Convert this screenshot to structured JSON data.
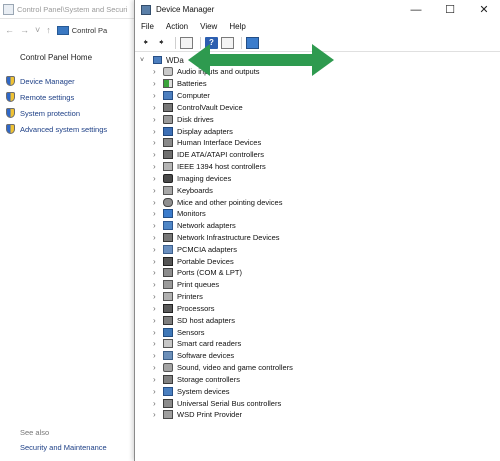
{
  "control_panel": {
    "title": "Control Panel\\System and Securi",
    "address": "Control Pa",
    "home_link": "Control Panel Home",
    "links": [
      "Device Manager",
      "Remote settings",
      "System protection",
      "Advanced system settings"
    ],
    "see_also": "See also",
    "security_maintenance": "Security and Maintenance"
  },
  "device_manager": {
    "title": "Device Manager",
    "menus": [
      "File",
      "Action",
      "View",
      "Help"
    ],
    "root_label": "WDa",
    "categories": [
      {
        "label": "Audio inputs and outputs",
        "icon": "speaker-icon"
      },
      {
        "label": "Batteries",
        "icon": "battery-icon"
      },
      {
        "label": "Computer",
        "icon": "computer-icon"
      },
      {
        "label": "ControlVault Device",
        "icon": "controlvault-icon"
      },
      {
        "label": "Disk drives",
        "icon": "disk-drive-icon"
      },
      {
        "label": "Display adapters",
        "icon": "display-adapter-icon"
      },
      {
        "label": "Human Interface Devices",
        "icon": "hid-icon"
      },
      {
        "label": "IDE ATA/ATAPI controllers",
        "icon": "ide-controller-icon"
      },
      {
        "label": "IEEE 1394 host controllers",
        "icon": "ieee1394-icon"
      },
      {
        "label": "Imaging devices",
        "icon": "camera-icon"
      },
      {
        "label": "Keyboards",
        "icon": "keyboard-icon"
      },
      {
        "label": "Mice and other pointing devices",
        "icon": "mouse-icon"
      },
      {
        "label": "Monitors",
        "icon": "monitor-icon"
      },
      {
        "label": "Network adapters",
        "icon": "network-adapter-icon"
      },
      {
        "label": "Network Infrastructure Devices",
        "icon": "network-infrastructure-icon"
      },
      {
        "label": "PCMCIA adapters",
        "icon": "pcmcia-icon"
      },
      {
        "label": "Portable Devices",
        "icon": "portable-device-icon"
      },
      {
        "label": "Ports (COM & LPT)",
        "icon": "port-icon"
      },
      {
        "label": "Print queues",
        "icon": "print-queue-icon"
      },
      {
        "label": "Printers",
        "icon": "printer-icon"
      },
      {
        "label": "Processors",
        "icon": "processor-icon"
      },
      {
        "label": "SD host adapters",
        "icon": "sd-card-icon"
      },
      {
        "label": "Sensors",
        "icon": "sensor-icon"
      },
      {
        "label": "Smart card readers",
        "icon": "smart-card-icon"
      },
      {
        "label": "Software devices",
        "icon": "software-device-icon"
      },
      {
        "label": "Sound, video and game controllers",
        "icon": "sound-icon"
      },
      {
        "label": "Storage controllers",
        "icon": "storage-controller-icon"
      },
      {
        "label": "System devices",
        "icon": "system-device-icon"
      },
      {
        "label": "Universal Serial Bus controllers",
        "icon": "usb-icon"
      },
      {
        "label": "WSD Print Provider",
        "icon": "wsd-printer-icon"
      }
    ]
  },
  "colors": {
    "annotation_arrow": "#2e9a4f",
    "link": "#1d3f86"
  }
}
